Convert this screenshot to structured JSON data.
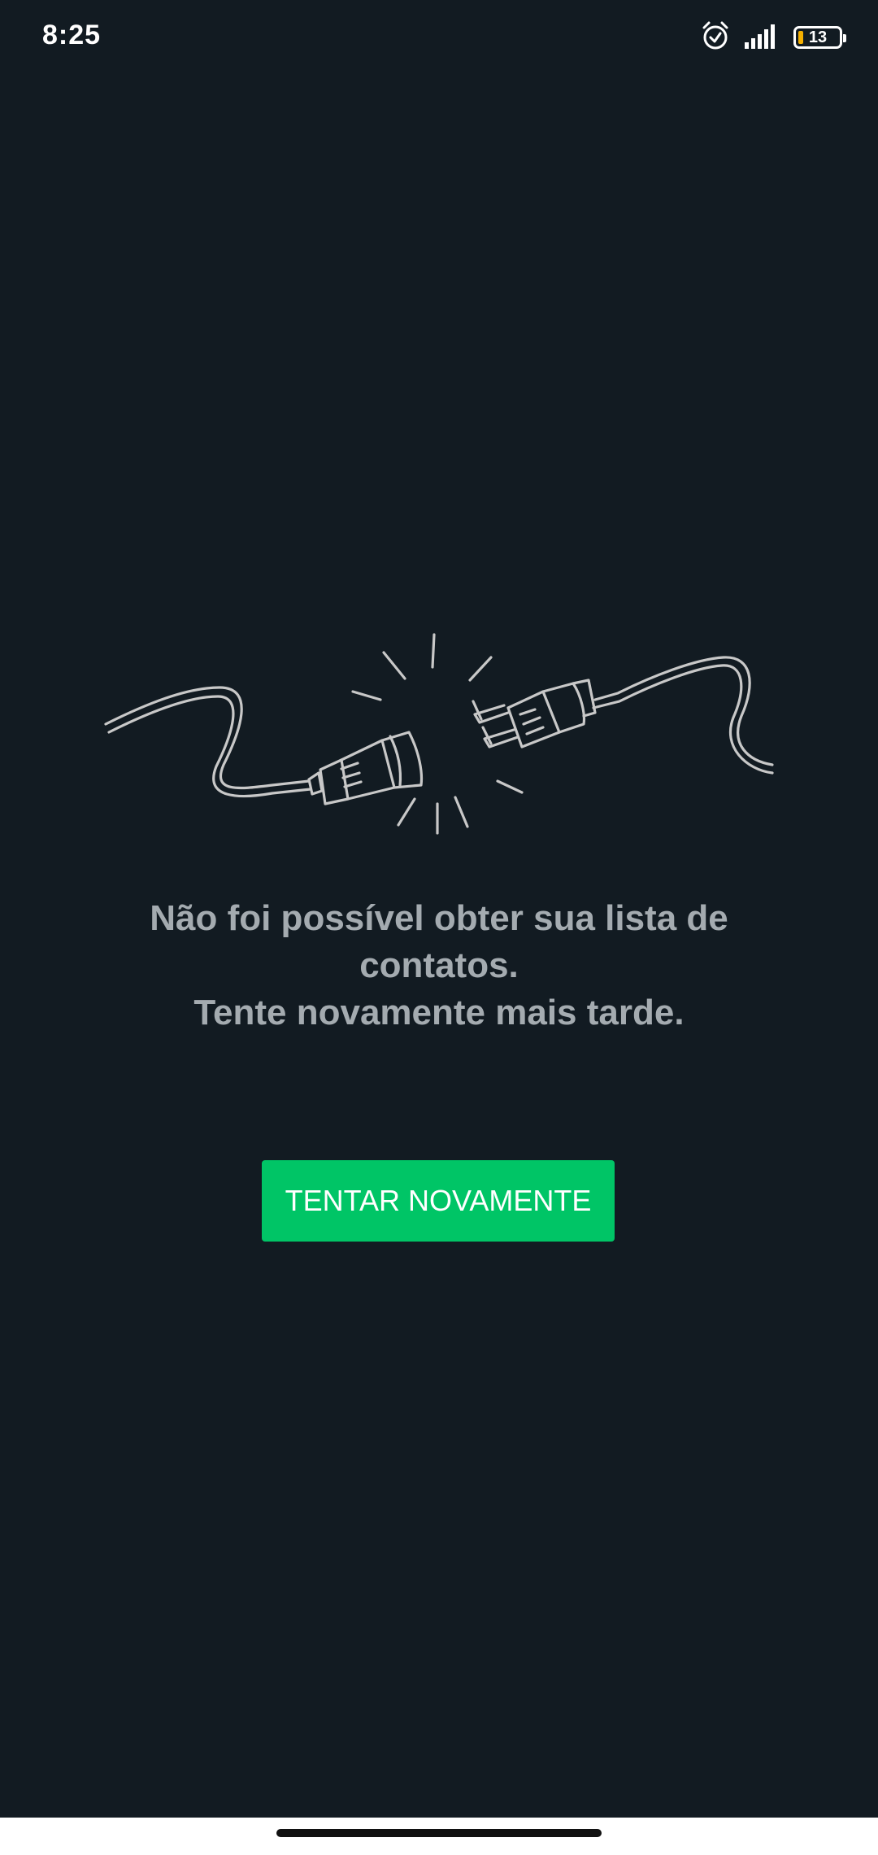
{
  "status_bar": {
    "time": "8:25",
    "battery_level": "13",
    "icons": [
      "alarm-icon",
      "signal-icon",
      "battery-icon"
    ],
    "battery_low_color": "#f5b000"
  },
  "illustration": {
    "icon": "unplugged-cable-icon"
  },
  "message": {
    "line1": "Não foi possível obter sua lista de",
    "line2": "contatos.",
    "line3": "Tente novamente mais tarde."
  },
  "retry_button": {
    "label": "TENTAR NOVAMENTE"
  },
  "colors": {
    "background": "#121b22",
    "accent": "#00c566",
    "message_text": "#a4abb0",
    "illustration_stroke": "#c8c8c8"
  }
}
